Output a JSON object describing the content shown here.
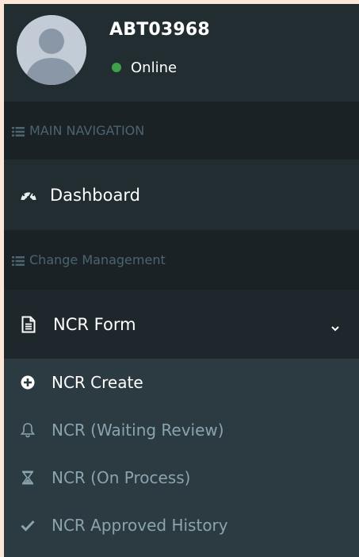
{
  "user": {
    "name": "ABT03968",
    "status": "Online",
    "status_color": "#3fa14a"
  },
  "nav": {
    "main_header": "MAIN NAVIGATION",
    "dashboard": {
      "label": "Dashboard",
      "icon": "dashboard-icon"
    },
    "change_header": "Change Management",
    "ncr_form": {
      "label": "NCR Form",
      "icon": "file-icon",
      "expanded": true
    },
    "sub_items": [
      {
        "label": "NCR Create",
        "icon": "plus-circle-icon",
        "active": true
      },
      {
        "label": "NCR (Waiting Review)",
        "icon": "bell-icon",
        "active": false
      },
      {
        "label": "NCR (On Process)",
        "icon": "hourglass-icon",
        "active": false
      },
      {
        "label": "NCR Approved History",
        "icon": "check-icon",
        "active": false
      }
    ]
  },
  "colors": {
    "sidebar_bg": "#222d32",
    "header_bg": "#1a2226",
    "submenu_bg": "#2c3b41",
    "muted_text": "#8aa4af",
    "page_bg": "#fbe6d8"
  }
}
